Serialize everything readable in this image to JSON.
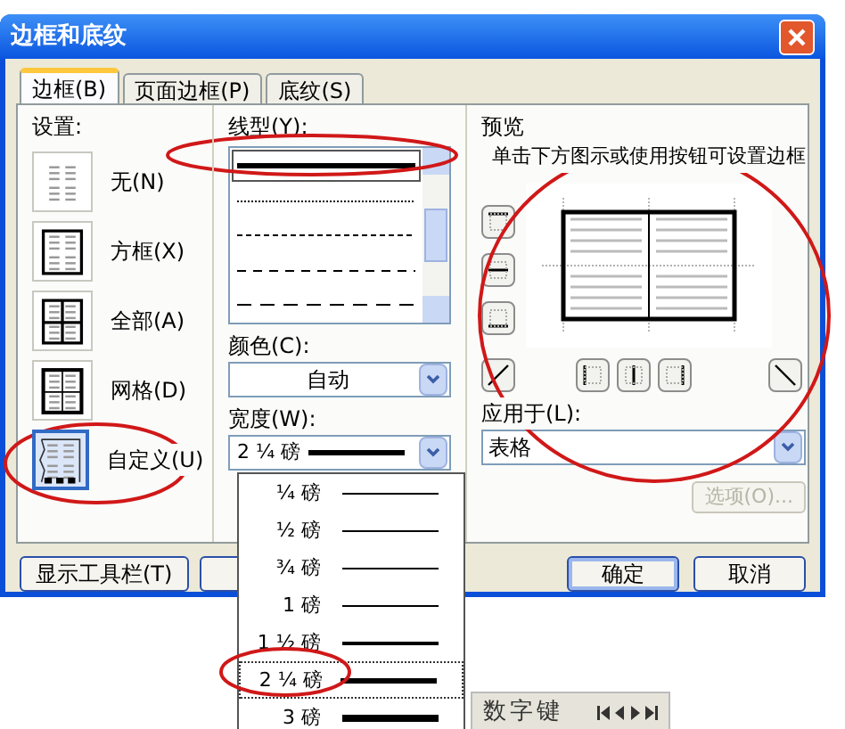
{
  "window": {
    "title": "边框和底纹"
  },
  "tabs": [
    {
      "label": "边框(B)",
      "selected": true
    },
    {
      "label": "页面边框(P)",
      "selected": false
    },
    {
      "label": "底纹(S)",
      "selected": false
    }
  ],
  "settings": {
    "label": "设置:",
    "items": [
      {
        "label": "无(N)",
        "kind": "none",
        "selected": false
      },
      {
        "label": "方框(X)",
        "kind": "box",
        "selected": false
      },
      {
        "label": "全部(A)",
        "kind": "all",
        "selected": false
      },
      {
        "label": "网格(D)",
        "kind": "grid",
        "selected": false
      },
      {
        "label": "自定义(U)",
        "kind": "custom",
        "selected": true
      }
    ]
  },
  "line_style": {
    "label": "线型(Y):",
    "items": [
      {
        "kind": "solid",
        "selected": true
      },
      {
        "kind": "dotted",
        "selected": false
      },
      {
        "kind": "fine-dash",
        "selected": false
      },
      {
        "kind": "dash",
        "selected": false
      },
      {
        "kind": "long-dash",
        "selected": false
      }
    ]
  },
  "color": {
    "label": "颜色(C):",
    "value": "自动"
  },
  "width": {
    "label": "宽度(W):",
    "value": "2 ¼ 磅",
    "kind": "thick",
    "expanded": true,
    "options": [
      {
        "label": "¼ 磅",
        "kind": "thin",
        "selected": false
      },
      {
        "label": "½ 磅",
        "kind": "thin",
        "selected": false
      },
      {
        "label": "¾ 磅",
        "kind": "thin",
        "selected": false
      },
      {
        "label": "1 磅",
        "kind": "thin",
        "selected": false
      },
      {
        "label": "1 ½ 磅",
        "kind": "medium",
        "selected": false
      },
      {
        "label": "2 ¼ 磅",
        "kind": "thick",
        "selected": true
      },
      {
        "label": "3 磅",
        "kind": "heavy",
        "selected": false
      }
    ]
  },
  "preview": {
    "label": "预览",
    "hint": "单击下方图示或使用按钮可设置边框"
  },
  "apply_to": {
    "label": "应用于(L):",
    "value": "表格"
  },
  "options_button": {
    "label": "选项(O)...",
    "disabled": true
  },
  "toolbar_button": {
    "label": "显示工具栏(T)"
  },
  "buttons": [
    {
      "label": "确定",
      "default": true
    },
    {
      "label": "取消",
      "default": false
    }
  ],
  "numpad_toolbar": {
    "title": "数字键"
  }
}
